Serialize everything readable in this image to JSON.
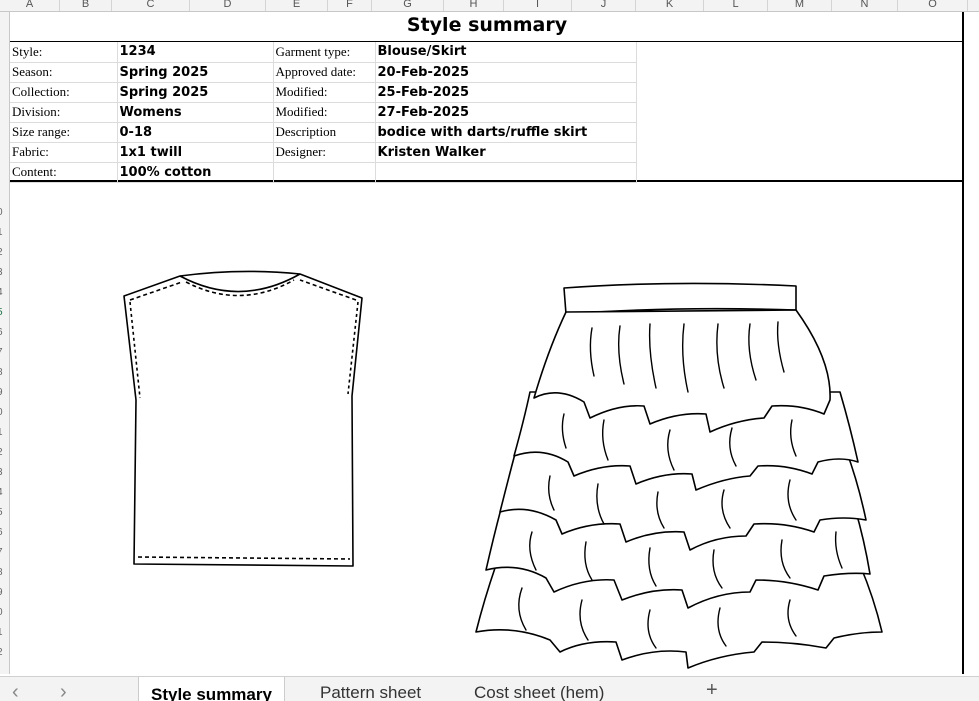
{
  "columns": [
    "A",
    "B",
    "C",
    "D",
    "E",
    "F",
    "G",
    "H",
    "I",
    "J",
    "K",
    "L",
    "M",
    "N",
    "O"
  ],
  "rows": [
    "0",
    "1",
    "2",
    "3",
    "4",
    "5",
    "6",
    "7",
    "8",
    "9",
    "0",
    "1",
    "2",
    "3",
    "4",
    "5",
    "6",
    "7",
    "8",
    "9",
    "0",
    "1",
    "2"
  ],
  "sheet": {
    "title": "Style summary",
    "info_rows": [
      {
        "label1": "Style:",
        "value1": "1234",
        "label2": "Garment type:",
        "value2": "Blouse/Skirt"
      },
      {
        "label1": "Season:",
        "value1": "Spring 2025",
        "label2": "Approved date:",
        "value2": "20-Feb-2025"
      },
      {
        "label1": "Collection:",
        "value1": "Spring 2025",
        "label2": "Modified:",
        "value2": "25-Feb-2025"
      },
      {
        "label1": "Division:",
        "value1": "Womens",
        "label2": "Modified:",
        "value2": "27-Feb-2025"
      },
      {
        "label1": "Size range:",
        "value1": "0-18",
        "label2": "Description",
        "value2": "bodice with darts/ruffle skirt"
      },
      {
        "label1": "Fabric:",
        "value1": "1x1 twill",
        "label2": "Designer:",
        "value2": "Kristen Walker"
      },
      {
        "label1": "Content:",
        "value1": "100% cotton",
        "label2": "",
        "value2": ""
      }
    ]
  },
  "tabs": {
    "active": "Style summary",
    "tab2": "Pattern sheet",
    "tab3": "Cost sheet (hem)",
    "add_icon": "plus-icon",
    "prev_icon": "chevron-left-icon",
    "next_icon": "chevron-right-icon"
  }
}
